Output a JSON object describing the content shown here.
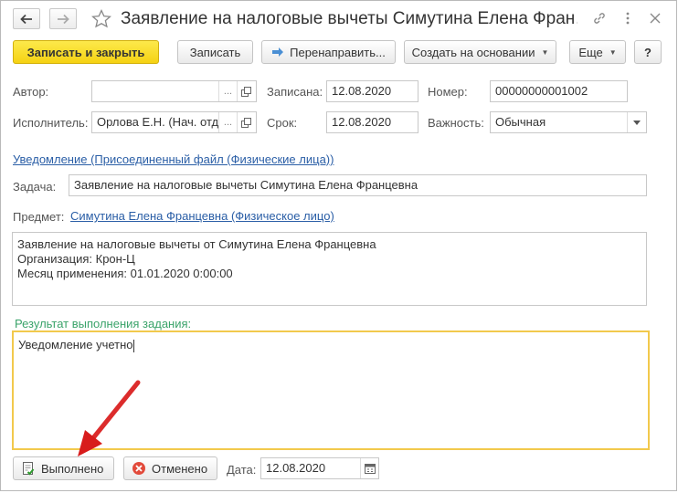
{
  "window": {
    "title": "Заявление на налоговые вычеты Симутина Елена Фран…"
  },
  "toolbar": {
    "save_close": "Записать и закрыть",
    "save": "Записать",
    "redirect": "Перенаправить...",
    "create_based": "Создать на основании",
    "more": "Еще",
    "help": "?"
  },
  "form": {
    "author_label": "Автор:",
    "author_value": "",
    "author_btn": "...",
    "written_label": "Записана:",
    "written_value": "12.08.2020",
    "number_label": "Номер:",
    "number_value": "00000000001002",
    "executor_label": "Исполнитель:",
    "executor_value": "Орлова Е.Н. (Нач. отд",
    "executor_btn": "...",
    "deadline_label": "Срок:",
    "deadline_value": "12.08.2020",
    "importance_label": "Важность:",
    "importance_value": "Обычная",
    "notice_link": "Уведомление (Присоединенный файл (Физические лица))",
    "task_label": "Задача:",
    "task_value": "Заявление на налоговые вычеты Симутина Елена Францевна",
    "subject_label": "Предмет:",
    "subject_link": "Симутина Елена Францевна (Физическое лицо)",
    "description": [
      "Заявление на налоговые вычеты от Симутина Елена Францевна",
      "Организация: Крон-Ц",
      "Месяц применения: 01.01.2020 0:00:00"
    ],
    "result_label": "Результат выполнения задания:",
    "result_value": "Уведомление учетно"
  },
  "bottom": {
    "done": "Выполнено",
    "cancelled": "Отменено",
    "date_label": "Дата:",
    "date_value": "12.08.2020"
  },
  "colors": {
    "primary_button": "#f5d213",
    "link": "#2a5ea6",
    "result_label": "#3aa36a",
    "result_border": "#f2c94c",
    "annotation_arrow": "#e02020"
  }
}
